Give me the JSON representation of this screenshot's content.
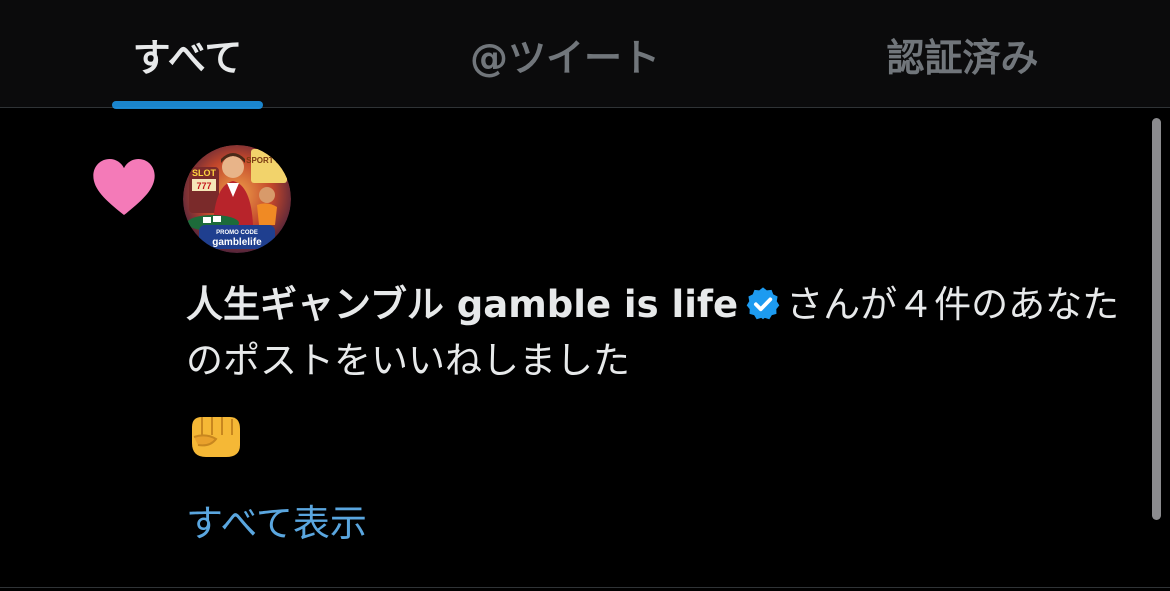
{
  "tabs": [
    {
      "label": "すべて",
      "active": true
    },
    {
      "label": "@ツイート",
      "active": false
    },
    {
      "label": "認証済み",
      "active": false
    }
  ],
  "notification": {
    "type_icon": "heart-icon",
    "type_icon_color": "#f47ab8",
    "avatar": {
      "text_slot": "SLOT",
      "text_sport": "SPORT BET",
      "text_promo": "PROMO CODE",
      "text_code": "gamblelife"
    },
    "user_name": "人生ギャンブル gamble is life",
    "verified": true,
    "verified_color": "#1d9bf0",
    "action_text": "さんが４件のあなたのポストをいいねしました",
    "post_content": "👊",
    "show_all_label": "すべて表示"
  },
  "colors": {
    "background": "#000000",
    "accent": "#1d9bf0",
    "link": "#5aa6df",
    "heart": "#f47ab8"
  }
}
